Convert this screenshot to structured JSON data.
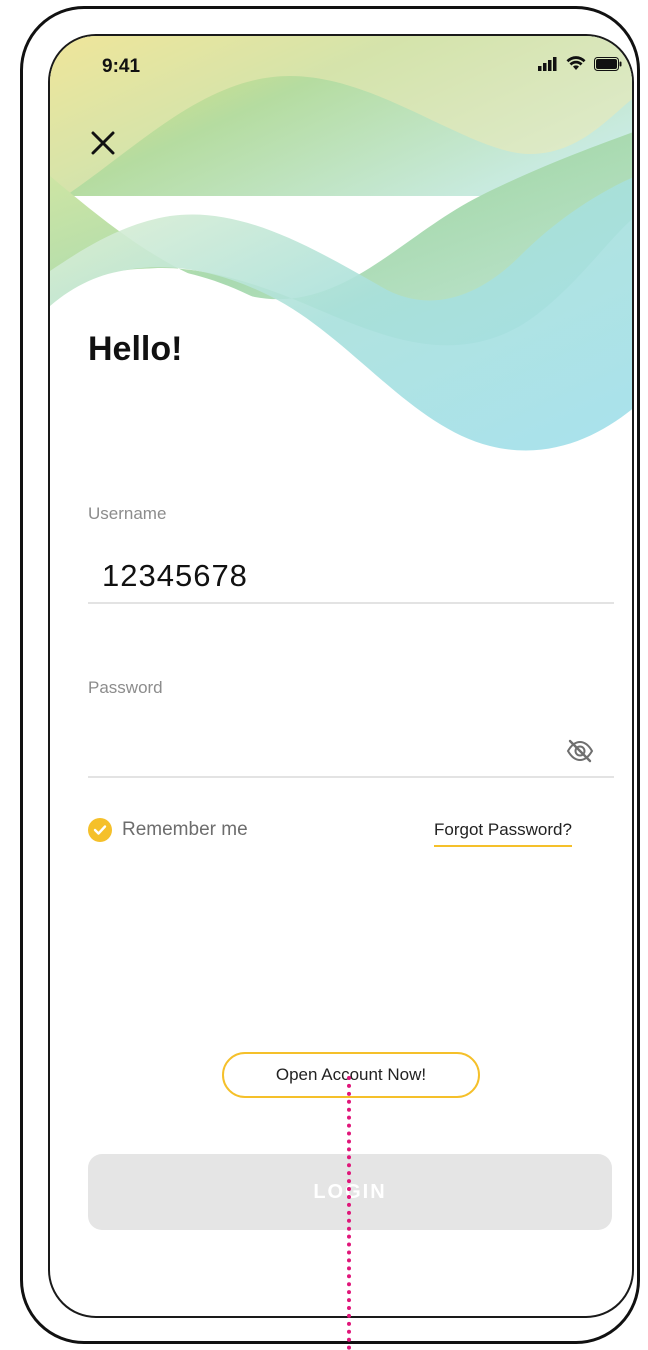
{
  "status_bar": {
    "time": "9:41"
  },
  "header": {
    "greeting": "Hello!"
  },
  "form": {
    "username": {
      "label": "Username",
      "value": "12345678"
    },
    "password": {
      "label": "Password",
      "value": ""
    },
    "remember_me": {
      "label": "Remember me",
      "checked": true
    },
    "forgot_password": "Forgot Password?"
  },
  "actions": {
    "open_account": "Open Account Now!",
    "login": "LOGIN"
  },
  "icons": [
    "close-icon",
    "eye-slash-icon",
    "checkmark-icon",
    "signal-icon",
    "wifi-icon",
    "battery-icon"
  ],
  "colors": {
    "accent": "#f5c02a",
    "login_disabled_bg": "#e5e5e5",
    "annotation": "#e0167a"
  }
}
